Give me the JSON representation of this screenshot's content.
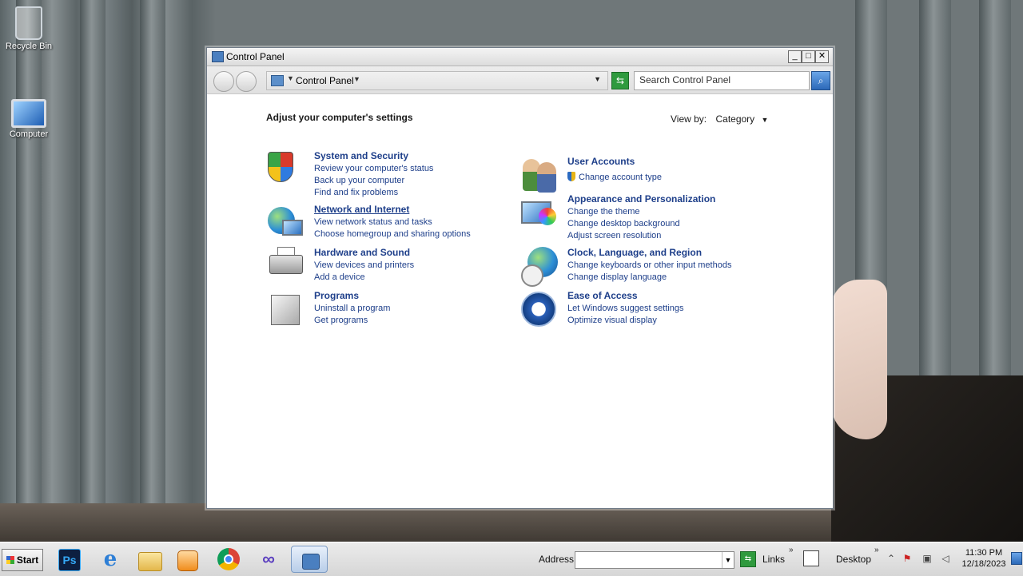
{
  "desktop": {
    "icons": [
      {
        "label": "Recycle Bin"
      },
      {
        "label": "Computer"
      }
    ]
  },
  "window": {
    "title": "Control Panel",
    "buttons": {
      "minimize": "_",
      "maximize": "□",
      "close": "✕"
    },
    "address": {
      "breadcrumb": "Control Panel"
    },
    "search": {
      "placeholder": "Search Control Panel"
    }
  },
  "content": {
    "heading": "Adjust your computer's settings",
    "view_by": {
      "label": "View by:",
      "value": "Category"
    },
    "categories_left": [
      {
        "title": "System and Security",
        "links": [
          "Review your computer's status",
          "Back up your computer",
          "Find and fix problems"
        ],
        "icon": "shield-icon"
      },
      {
        "title": "Network and Internet",
        "links": [
          "View network status and tasks",
          "Choose homegroup and sharing options"
        ],
        "icon": "network-globe-icon"
      },
      {
        "title": "Hardware and Sound",
        "links": [
          "View devices and printers",
          "Add a device"
        ],
        "icon": "printer-icon"
      },
      {
        "title": "Programs",
        "links": [
          "Uninstall a program",
          "Get programs"
        ],
        "icon": "programs-box-icon"
      }
    ],
    "categories_right": [
      {
        "title": "User Accounts",
        "links": [
          "Change account type"
        ],
        "icon": "users-icon"
      },
      {
        "title": "Appearance and Personalization",
        "links": [
          "Change the theme",
          "Change desktop background",
          "Adjust screen resolution"
        ],
        "icon": "monitor-palette-icon"
      },
      {
        "title": "Clock, Language, and Region",
        "links": [
          "Change keyboards or other input methods",
          "Change display language"
        ],
        "icon": "globe-clock-icon"
      },
      {
        "title": "Ease of Access",
        "links": [
          "Let Windows suggest settings",
          "Optimize visual display"
        ],
        "icon": "ease-of-access-icon"
      }
    ]
  },
  "taskbar": {
    "start_label": "Start",
    "apps": [
      "photoshop-icon",
      "internet-explorer-icon",
      "file-explorer-icon",
      "media-player-icon",
      "chrome-icon",
      "visual-studio-icon",
      "control-panel-icon"
    ],
    "photoshop_label": "Ps",
    "ie_label": "e",
    "vs_label": "∞",
    "address_label": "Address",
    "links_label": "Links",
    "desktop_label": "Desktop",
    "time": "11:30 PM",
    "date": "12/18/2023"
  }
}
